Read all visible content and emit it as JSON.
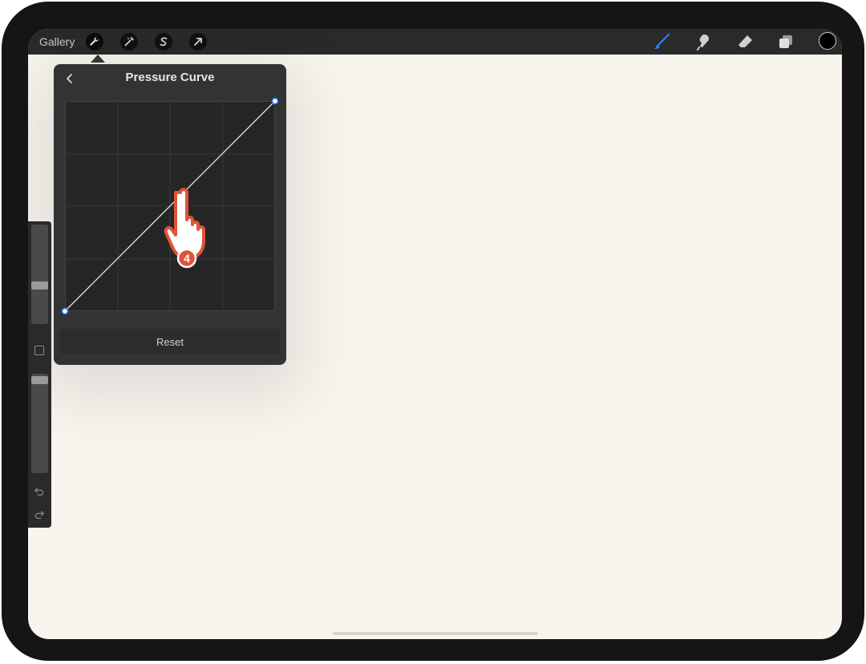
{
  "topbar": {
    "gallery_label": "Gallery",
    "left_tools": [
      "wrench-icon",
      "magic-wand-icon",
      "selection-s-icon",
      "transform-arrow-icon"
    ],
    "right_tools": [
      "brush-icon",
      "smudge-icon",
      "eraser-icon",
      "layers-icon"
    ],
    "current_color": "#000000",
    "accent_color": "#2f7cf6"
  },
  "popup": {
    "title": "Pressure Curve",
    "reset_label": "Reset",
    "curve_points": [
      [
        0,
        0
      ],
      [
        1,
        1
      ]
    ]
  },
  "annotation": {
    "step_number": "4",
    "step_color": "#e0543a"
  }
}
